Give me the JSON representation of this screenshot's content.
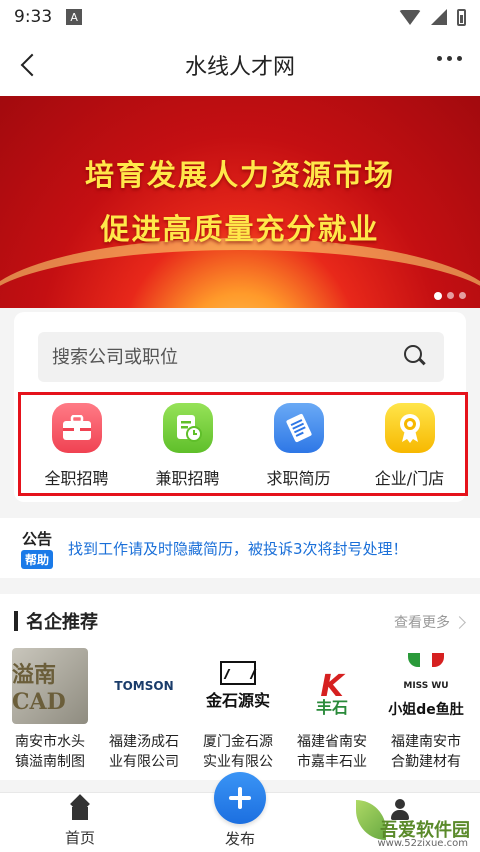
{
  "status_bar": {
    "time": "9:33",
    "notification_letter": "A"
  },
  "nav": {
    "title": "水线人才网"
  },
  "banner": {
    "line1": "培育发展人力资源市场",
    "line2": "促进高质量充分就业"
  },
  "search": {
    "placeholder": "搜索公司或职位"
  },
  "categories": [
    {
      "label": "全职招聘",
      "icon": "briefcase-icon",
      "color": "#f04252"
    },
    {
      "label": "兼职招聘",
      "icon": "document-clock-icon",
      "color": "#5fbf2a"
    },
    {
      "label": "求职简历",
      "icon": "resume-icon",
      "color": "#2e77e6"
    },
    {
      "label": "企业/门店",
      "icon": "medal-icon",
      "color": "#f7b800"
    }
  ],
  "notice": {
    "title": "公告",
    "badge": "帮助",
    "text": "找到工作请及时隐藏简历，被投诉3次将封号处理！"
  },
  "companies": {
    "title": "名企推荐",
    "more": "查看更多",
    "items": [
      {
        "name_line1": "南安市水头",
        "name_line2": "镇溢南制图",
        "logo_text": "溢南CAD"
      },
      {
        "name_line1": "福建汤成石",
        "name_line2": "业有限公司",
        "logo_text": "TOMSON"
      },
      {
        "name_line1": "厦门金石源",
        "name_line2": "实业有限公",
        "logo_text": "金石源实"
      },
      {
        "name_line1": "福建省南安",
        "name_line2": "市嘉丰石业",
        "logo_text": "丰石"
      },
      {
        "name_line1": "福建南安市",
        "name_line2": "合勤建材有",
        "logo_text": "小姐de鱼肚"
      }
    ],
    "logo_subtext": {
      "miss": "MISS WU"
    }
  },
  "tabs": {
    "home": "首页",
    "publish": "发布"
  },
  "watermark": {
    "brand": "吾爱软件园",
    "url": "www.52zixue.com"
  },
  "colors": {
    "accent": "#1c6fe0",
    "highlight_border": "#e5121b",
    "banner_text": "#ffe84a"
  }
}
